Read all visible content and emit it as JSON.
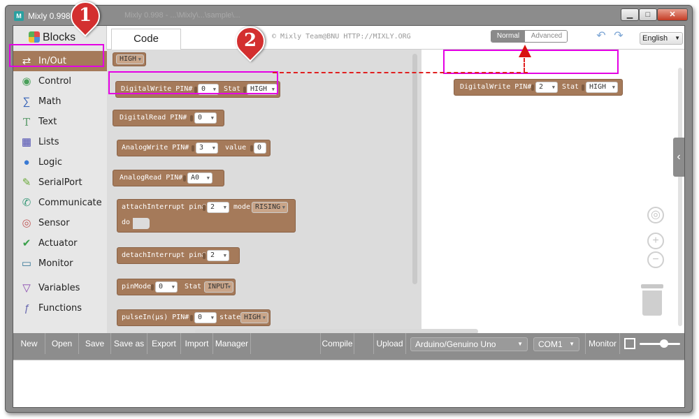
{
  "window": {
    "title": "Mixly 0.998",
    "ghost_title": "Mixly 0.998 - ...\\Mixly\\...\\sample\\...",
    "minimize_glyph": "▁",
    "maximize_glyph": "□",
    "close_glyph": "✕"
  },
  "header": {
    "tabs": {
      "blocks": "Blocks",
      "code": "Code"
    },
    "copyright": "© Mixly Team@BNU HTTP://MIXLY.ORG",
    "mode": {
      "normal": "Normal",
      "advanced": "Advanced",
      "selected": "Normal"
    },
    "language": "English",
    "undo_glyph": "↶",
    "redo_glyph": "↷"
  },
  "sidebar": {
    "items": [
      {
        "label": "In/Out",
        "icon": "in-out-icon",
        "glyph": "⇄",
        "active": true,
        "color": "#ffffff"
      },
      {
        "label": "Control",
        "icon": "gamepad-icon",
        "glyph": "◉",
        "color": "#4aa05a"
      },
      {
        "label": "Math",
        "icon": "math-icon",
        "glyph": "∑",
        "color": "#3a66b8"
      },
      {
        "label": "Text",
        "icon": "text-icon",
        "glyph": "T",
        "color": "#5a9a6a"
      },
      {
        "label": "Lists",
        "icon": "lists-icon",
        "glyph": "▦",
        "color": "#4a4ab0"
      },
      {
        "label": "Logic",
        "icon": "bulb-icon",
        "glyph": "●",
        "color": "#3a7ad4"
      },
      {
        "label": "SerialPort",
        "icon": "serial-icon",
        "glyph": "✎",
        "color": "#6aaa3a"
      },
      {
        "label": "Communicate",
        "icon": "communicate-icon",
        "glyph": "✆",
        "color": "#3a9a7a"
      },
      {
        "label": "Sensor",
        "icon": "sensor-icon",
        "glyph": "◎",
        "color": "#c05a5a"
      },
      {
        "label": "Actuator",
        "icon": "actuator-icon",
        "glyph": "✔",
        "color": "#3aa04a"
      },
      {
        "label": "Monitor",
        "icon": "monitor-icon",
        "glyph": "▭",
        "color": "#3a7a9a"
      },
      {
        "label": "Variables",
        "icon": "variables-icon",
        "glyph": "▽",
        "color": "#8a4ab0"
      },
      {
        "label": "Functions",
        "icon": "functions-icon",
        "glyph": "ƒ",
        "color": "#6a6ab0"
      }
    ]
  },
  "flyout": {
    "high_block": "HIGH",
    "digitalwrite": {
      "label": "DigitalWrite PIN#",
      "pin": "0",
      "stat_label": "Stat",
      "stat": "HIGH"
    },
    "digitalread": {
      "label": "DigitalRead PIN#",
      "pin": "0"
    },
    "analogwrite": {
      "label": "AnalogWrite PIN#",
      "pin": "3",
      "value_label": "value",
      "value": "0"
    },
    "analogread": {
      "label": "AnalogRead PIN#",
      "pin": "A0"
    },
    "attachinterrupt": {
      "label": "attachInterrupt pin#",
      "pin": "2",
      "mode_label": "mode",
      "mode": "RISING",
      "do_label": "do"
    },
    "detachinterrupt": {
      "label": "detachInterrupt pin#",
      "pin": "2"
    },
    "pinmode": {
      "label": "pinMode",
      "pin": "0",
      "stat_label": "Stat",
      "stat": "INPUT"
    },
    "pulsein": {
      "label": "pulseIn(μs) PIN#",
      "pin": "0",
      "state_label": "state",
      "state": "HIGH"
    }
  },
  "workspace": {
    "block": {
      "label": "DigitalWrite PIN#",
      "pin": "2",
      "stat_label": "Stat",
      "stat": "HIGH"
    },
    "collapse_glyph": "‹",
    "center_glyph": "◎",
    "zoom_in_glyph": "+",
    "zoom_out_glyph": "−"
  },
  "toolbar": {
    "new": "New",
    "open": "Open",
    "save": "Save",
    "save_as": "Save as",
    "export": "Export",
    "import": "Import",
    "manager": "Manager",
    "compile": "Compile",
    "upload": "Upload",
    "board": "Arduino/Genuino Uno",
    "port": "COM1",
    "monitor": "Monitor",
    "zoom_level": 0.6
  },
  "annotations": {
    "marker_1": "1",
    "marker_2": "2",
    "highlight_color": "#e400e4",
    "arrow_color": "#e02020"
  },
  "dropdown_caret": "▼"
}
